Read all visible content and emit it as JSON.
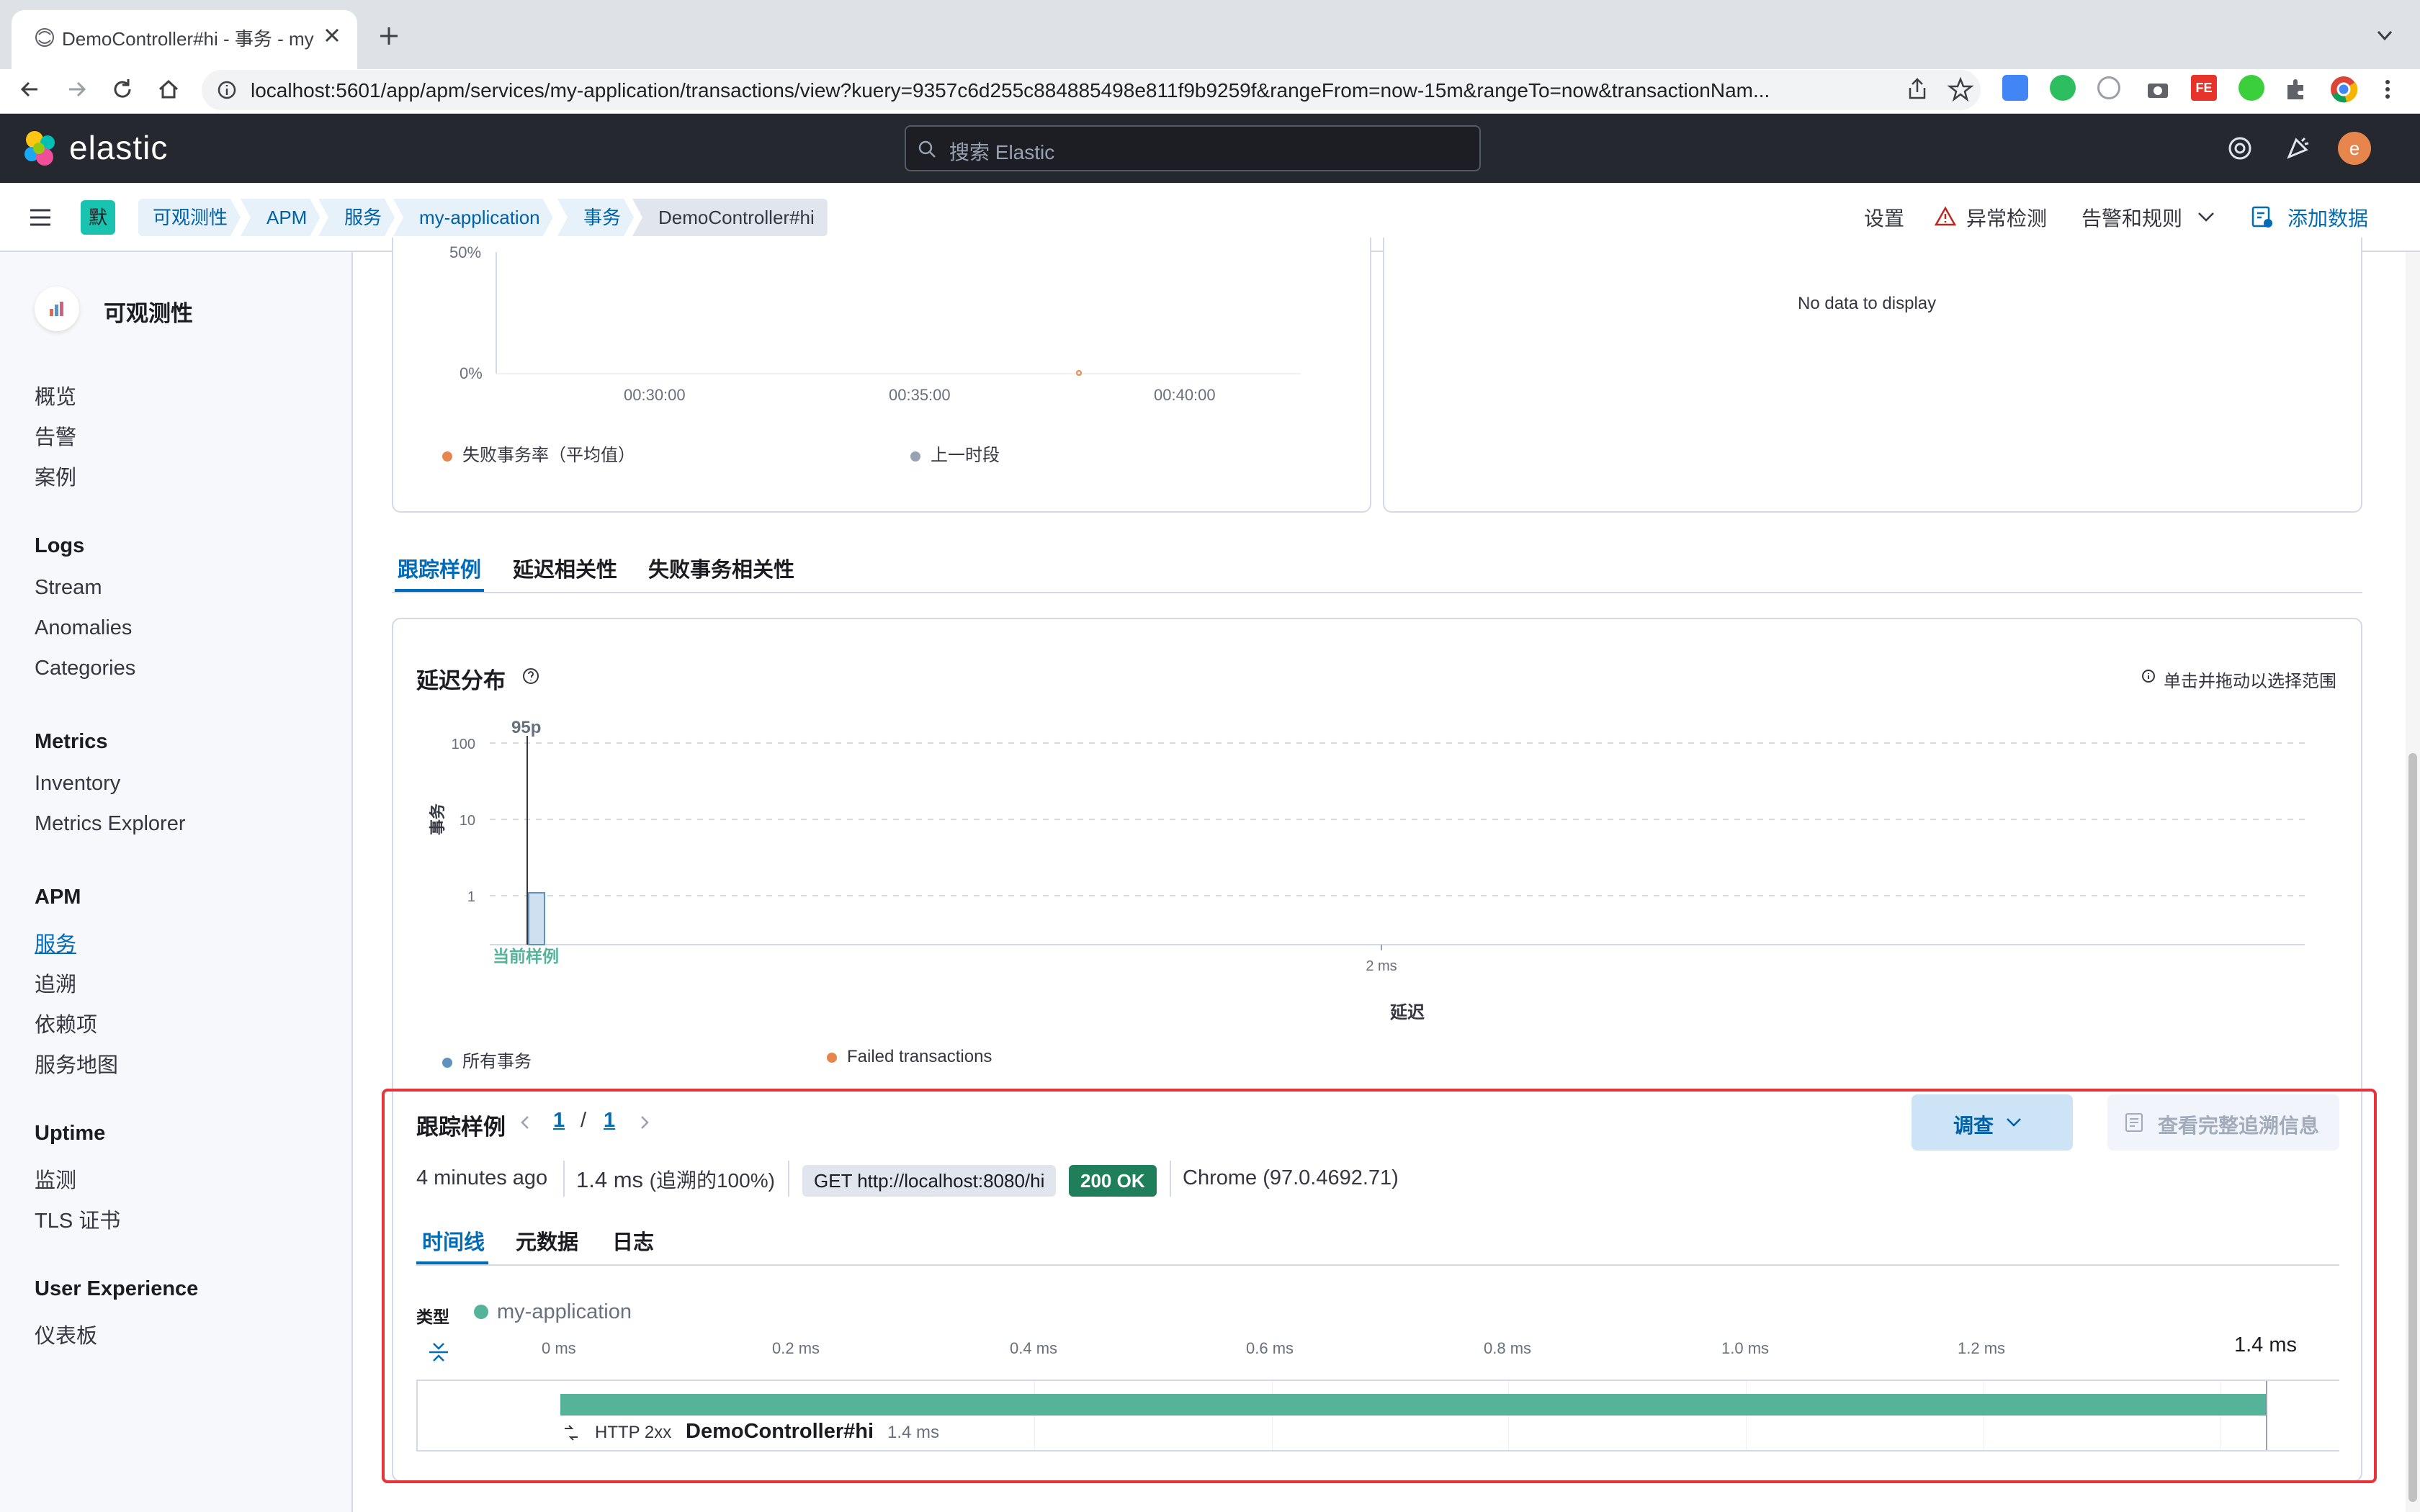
{
  "browser": {
    "tab_title": "DemoController#hi - 事务 - my-application - 服务 - APM - 可观测性 - Elastic",
    "url": "localhost:5601/app/apm/services/my-application/transactions/view?kuery=9357c6d255c884885498e811f9b9259f&rangeFrom=now-15m&rangeTo=now&transactionNam..."
  },
  "header": {
    "logo_text": "elastic",
    "search_placeholder": "搜索 Elastic",
    "avatar_letter": "e"
  },
  "breadcrumbs": [
    "可观测性",
    "APM",
    "服务",
    "my-application",
    "事务",
    "DemoController#hi"
  ],
  "space_badge": "默",
  "header_links": {
    "settings": "设置",
    "anomaly": "异常检测",
    "alerts": "告警和规则",
    "add_data": "添加数据"
  },
  "sidebar": {
    "title": "可观测性",
    "groups": [
      {
        "heading": "",
        "items": [
          "概览",
          "告警",
          "案例"
        ]
      },
      {
        "heading": "Logs",
        "items": [
          "Stream",
          "Anomalies",
          "Categories"
        ]
      },
      {
        "heading": "Metrics",
        "items": [
          "Inventory",
          "Metrics Explorer"
        ]
      },
      {
        "heading": "APM",
        "items": [
          "服务",
          "追溯",
          "依赖项",
          "服务地图"
        ]
      },
      {
        "heading": "Uptime",
        "items": [
          "监测",
          "TLS 证书"
        ]
      },
      {
        "heading": "User Experience",
        "items": [
          "仪表板"
        ]
      }
    ]
  },
  "error_rate_panel": {
    "y_ticks": [
      "50%",
      "0%"
    ],
    "x_ticks": [
      "00:30:00",
      "00:35:00",
      "00:40:00"
    ],
    "legend": [
      "失败事务率（平均值）",
      "上一时段"
    ]
  },
  "right_panel": {
    "empty_text": "No data to display"
  },
  "tabs": [
    "跟踪样例",
    "延迟相关性",
    "失败事务相关性"
  ],
  "latency": {
    "title": "延迟分布",
    "hint": "单击并拖动以选择范围",
    "ylabel": "事务",
    "xlabel": "延迟",
    "percentile_label": "95p",
    "current_sample_label": "当前样例",
    "legend": [
      "所有事务",
      "Failed transactions"
    ]
  },
  "chart_data": {
    "type": "bar",
    "title": "延迟分布",
    "xlabel": "延迟",
    "ylabel": "事务",
    "y_scale": "log",
    "y_ticks": [
      "100",
      "10",
      "1"
    ],
    "x_ticks": [
      "2 ms"
    ],
    "series": [
      {
        "name": "所有事务",
        "values": [
          1
        ]
      }
    ],
    "annotations": [
      "95p",
      "当前样例"
    ],
    "legend": [
      "所有事务",
      "Failed transactions"
    ]
  },
  "trace": {
    "title": "跟踪样例",
    "page_current": "1",
    "page_sep": "/",
    "page_total": "1",
    "investigate_label": "调查",
    "full_trace_label": "查看完整追溯信息",
    "time_ago": "4 minutes ago",
    "duration": "1.4 ms",
    "duration_pct": "(追溯的100%)",
    "request": "GET http://localhost:8080/hi",
    "status": "200 OK",
    "user_agent": "Chrome (97.0.4692.71)",
    "subtabs": [
      "时间线",
      "元数据",
      "日志"
    ],
    "type_label": "类型",
    "service": "my-application",
    "axis_ticks": [
      "0 ms",
      "0.2 ms",
      "0.4 ms",
      "0.6 ms",
      "0.8 ms",
      "1.0 ms",
      "1.2 ms"
    ],
    "axis_end": "1.4 ms",
    "span": {
      "http": "HTTP 2xx",
      "name": "DemoController#hi",
      "duration": "1.4 ms"
    }
  },
  "colors": {
    "accent": "#006bb8",
    "service": "#54b399",
    "failed": "#e7664c",
    "highlight_border": "#e7343a"
  }
}
